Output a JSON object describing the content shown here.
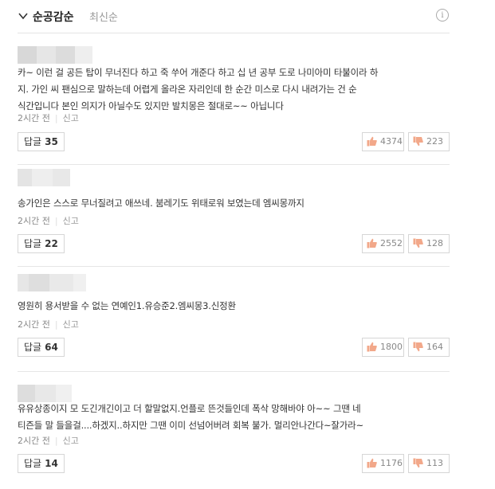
{
  "header": {
    "sort_active": "순공감순",
    "sort_other": "최신순",
    "info_label": "i"
  },
  "comments": [
    {
      "lines": [
        "카~ 이런 걸 공든 탑이 무너진다 하고 죽 쑤어 개준다 하고 십 년 공부 도로 나미아미 타불이라 하",
        "지. 가인 씨 팬심으로 말하는데 어렵게 올라온 자리인데 한 순간 미스로 다시 내려가는 건 순",
        "식간입니다 본인 의지가 아닐수도 있지만 발치몽은 절대로~~ 아닙니다"
      ],
      "time": "2시간 전",
      "report": "신고",
      "reply_label": "답글",
      "reply_count": "35",
      "likes": "4374",
      "dislikes": "223"
    },
    {
      "lines": [
        "송가인은 스스로 무너질려고 애쓰네. 붐레기도 위태로워 보였는데 엠씨몽까지"
      ],
      "time": "2시간 전",
      "report": "신고",
      "reply_label": "답글",
      "reply_count": "22",
      "likes": "2552",
      "dislikes": "128"
    },
    {
      "lines": [
        "영원히 용서받을 수 없는 연예인1.유승준2.엠씨몽3.신정환"
      ],
      "time": "2시간 전",
      "report": "신고",
      "reply_label": "답글",
      "reply_count": "64",
      "likes": "1800",
      "dislikes": "164"
    },
    {
      "lines": [
        "유유상종이지 모 도긴개긴이고 더 할말없지.언플로 뜬것들인데 폭삭 망해바야 아~~ 그땐 네",
        "티즌들 말 들을걸....하겠지..하지만 그땐 이미 선넘어버려 회복 불가. 멀리안나간다~잘가라~"
      ],
      "time": "2시간 전",
      "report": "신고",
      "reply_label": "답글",
      "reply_count": "14",
      "likes": "1176",
      "dislikes": "113"
    }
  ]
}
